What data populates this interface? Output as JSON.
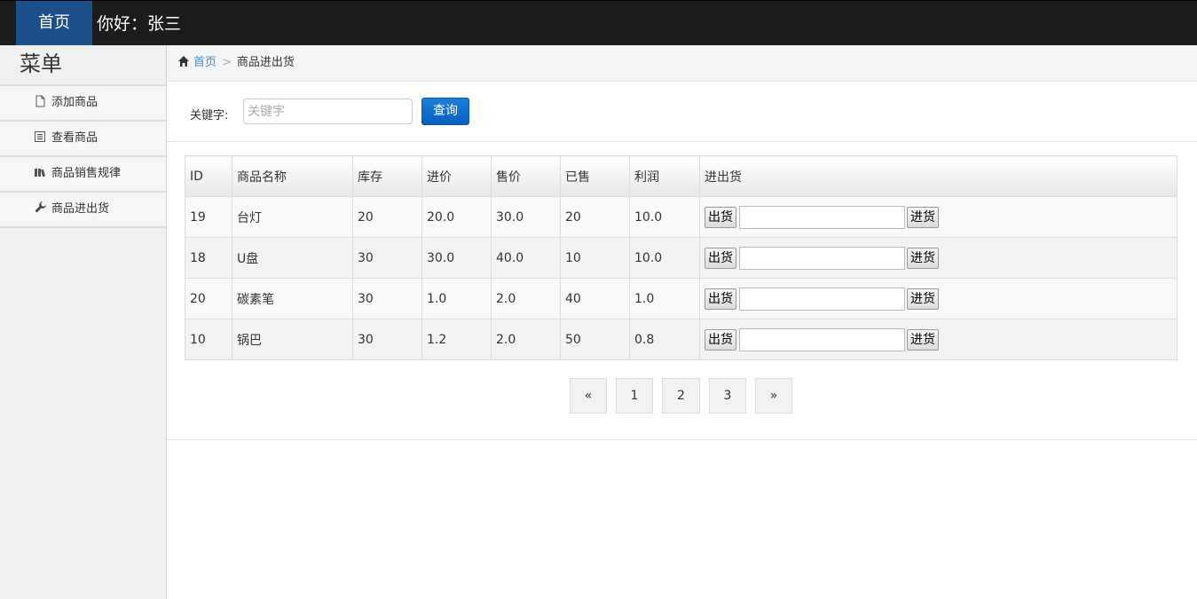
{
  "topbar": {
    "home_label": "首页",
    "greeting": "你好：张三"
  },
  "sidebar": {
    "title": "菜单",
    "items": [
      {
        "label": "添加商品",
        "icon": "file-icon"
      },
      {
        "label": "查看商品",
        "icon": "list-icon"
      },
      {
        "label": "商品销售规律",
        "icon": "books-icon"
      },
      {
        "label": "商品进出货",
        "icon": "wrench-icon"
      }
    ]
  },
  "breadcrumb": {
    "home": "首页",
    "separator": ">",
    "current": "商品进出货"
  },
  "search": {
    "label": "关键字:",
    "placeholder": "关键字",
    "button": "查询"
  },
  "table": {
    "headers": [
      "ID",
      "商品名称",
      "库存",
      "进价",
      "售价",
      "已售",
      "利润",
      "进出货"
    ],
    "out_label": "出货",
    "in_label": "进货",
    "rows": [
      {
        "id": "19",
        "name": "台灯",
        "stock": "20",
        "cost": "20.0",
        "price": "30.0",
        "sold": "20",
        "profit": "10.0"
      },
      {
        "id": "18",
        "name": "U盘",
        "stock": "30",
        "cost": "30.0",
        "price": "40.0",
        "sold": "10",
        "profit": "10.0"
      },
      {
        "id": "20",
        "name": "碳素笔",
        "stock": "30",
        "cost": "1.0",
        "price": "2.0",
        "sold": "40",
        "profit": "1.0"
      },
      {
        "id": "10",
        "name": "锅巴",
        "stock": "30",
        "cost": "1.2",
        "price": "2.0",
        "sold": "50",
        "profit": "0.8"
      }
    ]
  },
  "pagination": {
    "prev": "«",
    "pages": [
      "1",
      "2",
      "3"
    ],
    "next": "»"
  },
  "colors": {
    "topbar": "#1c1c1c",
    "home_active": "#1d4f8a",
    "link": "#428bca",
    "primary_button": "#0a5fc0"
  }
}
